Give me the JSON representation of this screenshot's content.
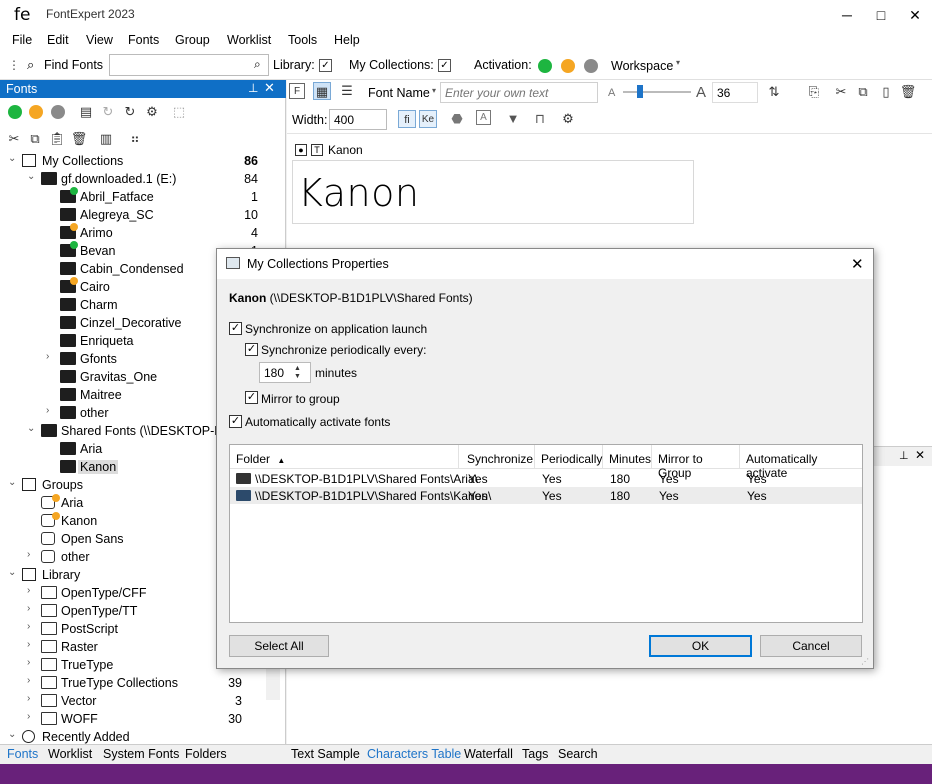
{
  "window": {
    "logo": "fe",
    "title": "FontExpert 2023",
    "minimize": "─",
    "maximize": "□",
    "close": "✕"
  },
  "menu": [
    "File",
    "Edit",
    "View",
    "Fonts",
    "Group",
    "Worklist",
    "Tools",
    "Help"
  ],
  "toolbar": {
    "find_fonts": "Find Fonts",
    "search_value": "",
    "library_label": "Library:",
    "my_collections_label": "My Collections:",
    "activation_label": "Activation:",
    "workspace_label": "Workspace"
  },
  "fonts_panel": {
    "title": "Fonts",
    "tree": [
      {
        "level": 0,
        "arrow": "⌄",
        "label": "My Collections",
        "count": "86",
        "icon": "collections",
        "bold_count": true
      },
      {
        "level": 1,
        "arrow": "⌄",
        "label": "gf.downloaded.1 (E:)",
        "count": "84",
        "icon": "drive"
      },
      {
        "level": 2,
        "label": "Abril_Fatface",
        "count": "1",
        "icon": "folder",
        "dot": "green"
      },
      {
        "level": 2,
        "label": "Alegreya_SC",
        "count": "10",
        "icon": "folder"
      },
      {
        "level": 2,
        "label": "Arimo",
        "count": "4",
        "icon": "folder",
        "dot": "orange"
      },
      {
        "level": 2,
        "label": "Bevan",
        "count": "1",
        "icon": "folder",
        "dot": "green"
      },
      {
        "level": 2,
        "label": "Cabin_Condensed",
        "count": "",
        "icon": "folder"
      },
      {
        "level": 2,
        "label": "Cairo",
        "count": "",
        "icon": "folder",
        "dot": "orange"
      },
      {
        "level": 2,
        "label": "Charm",
        "count": "",
        "icon": "folder"
      },
      {
        "level": 2,
        "label": "Cinzel_Decorative",
        "count": "",
        "icon": "folder"
      },
      {
        "level": 2,
        "label": "Enriqueta",
        "count": "",
        "icon": "folder"
      },
      {
        "level": 2,
        "arrow": "›",
        "label": "Gfonts",
        "count": "",
        "icon": "folder"
      },
      {
        "level": 2,
        "label": "Gravitas_One",
        "count": "",
        "icon": "folder"
      },
      {
        "level": 2,
        "label": "Maitree",
        "count": "",
        "icon": "folder"
      },
      {
        "level": 2,
        "arrow": "›",
        "label": "other",
        "count": "",
        "icon": "folder"
      },
      {
        "level": 1,
        "arrow": "⌄",
        "label": "Shared Fonts (\\\\DESKTOP-B1D",
        "count": "",
        "icon": "shared"
      },
      {
        "level": 2,
        "label": "Aria",
        "count": "",
        "icon": "folder"
      },
      {
        "level": 2,
        "label": "Kanon",
        "count": "",
        "icon": "folder",
        "selected": true
      },
      {
        "level": 0,
        "arrow": "⌄",
        "label": "Groups",
        "count": "",
        "icon": "groups"
      },
      {
        "level": 1,
        "label": "Aria",
        "count": "",
        "icon": "group",
        "dot": "orange"
      },
      {
        "level": 1,
        "label": "Kanon",
        "count": "",
        "icon": "group",
        "dot": "orange"
      },
      {
        "level": 1,
        "label": "Open Sans",
        "count": "",
        "icon": "group"
      },
      {
        "level": 1,
        "arrow": "›",
        "label": "other",
        "count": "",
        "icon": "group"
      },
      {
        "level": 0,
        "arrow": "⌄",
        "label": "Library",
        "count": "",
        "icon": "library"
      },
      {
        "level": 1,
        "arrow": "›",
        "label": "OpenType/CFF",
        "count": "",
        "icon": "ofolder"
      },
      {
        "level": 1,
        "arrow": "›",
        "label": "OpenType/TT",
        "count": "",
        "icon": "ofolder"
      },
      {
        "level": 1,
        "arrow": "›",
        "label": "PostScript",
        "count": "",
        "icon": "ofolder"
      },
      {
        "level": 1,
        "arrow": "›",
        "label": "Raster",
        "count": "",
        "icon": "ofolder"
      },
      {
        "level": 1,
        "arrow": "›",
        "label": "TrueType",
        "count": "",
        "icon": "ofolder"
      },
      {
        "level": 1,
        "arrow": "›",
        "label": "TrueType Collections",
        "count": "39",
        "icon": "ofolder"
      },
      {
        "level": 1,
        "arrow": "›",
        "label": "Vector",
        "count": "3",
        "icon": "ofolder"
      },
      {
        "level": 1,
        "arrow": "›",
        "label": "WOFF",
        "count": "30",
        "icon": "ofolder"
      },
      {
        "level": 0,
        "arrow": "⌄",
        "label": "Recently Added",
        "count": "",
        "icon": "clock"
      }
    ]
  },
  "left_tabs": [
    "Fonts",
    "Worklist",
    "System Fonts",
    "Folders"
  ],
  "right_tabs": [
    "Text Sample",
    "Characters Table",
    "Waterfall",
    "Tags",
    "Search"
  ],
  "view_toolbar": {
    "font_name_label": "Font Name",
    "sample_placeholder": "Enter your own text",
    "size_small_a": "A",
    "size_large_a": "A",
    "size_value": "36",
    "width_label": "Width:",
    "width_value": "400"
  },
  "sample": {
    "font_name": "Kanon",
    "sample_text": "Kanon"
  },
  "dialog": {
    "title": "My Collections Properties",
    "header_name": "Kanon",
    "header_path": " (\\\\DESKTOP-B1D1PLV\\Shared Fonts)",
    "sync_launch": "Synchronize on application launch",
    "sync_periodic": "Synchronize periodically every:",
    "interval_value": "180",
    "interval_unit": "minutes",
    "mirror": "Mirror to group",
    "auto_activate": "Automatically activate fonts",
    "columns": [
      "Folder",
      "Synchronize",
      "Periodically",
      "Minutes",
      "Mirror to Group",
      "Automatically activate"
    ],
    "rows": [
      [
        "\\\\DESKTOP-B1D1PLV\\Shared Fonts\\Aria\\",
        "Yes",
        "Yes",
        "180",
        "Yes",
        "Yes"
      ],
      [
        "\\\\DESKTOP-B1D1PLV\\Shared Fonts\\Kanon\\",
        "Yes",
        "Yes",
        "180",
        "Yes",
        "Yes"
      ]
    ],
    "select_all": "Select All",
    "ok": "OK",
    "cancel": "Cancel",
    "close": "✕"
  },
  "colors": {
    "accent": "#0f6fc6",
    "status_bar": "#68217a",
    "active_tab": "#1e74c8",
    "green": "#1db540",
    "orange": "#f5a623"
  }
}
